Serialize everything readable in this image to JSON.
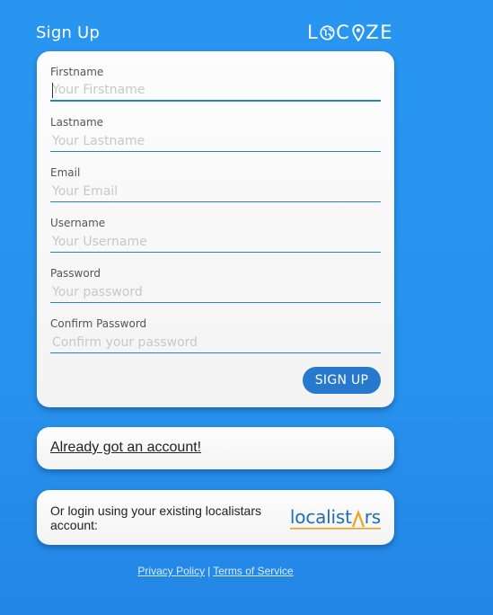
{
  "header": {
    "title": "Sign Up",
    "logo_letters_before": "L",
    "logo_letters_middle": "C",
    "logo_letters_after": "ZE",
    "logo_icons": [
      "globe-icon",
      "map-pin-icon"
    ]
  },
  "form": {
    "fields": [
      {
        "label": "Firstname",
        "placeholder": "Your Firstname",
        "value": ""
      },
      {
        "label": "Lastname",
        "placeholder": "Your Lastname",
        "value": ""
      },
      {
        "label": "Email",
        "placeholder": "Your Email",
        "value": ""
      },
      {
        "label": "Username",
        "placeholder": "Your Username",
        "value": ""
      },
      {
        "label": "Password",
        "placeholder": "Your password",
        "value": ""
      },
      {
        "label": "Confirm Password",
        "placeholder": "Confirm your password",
        "value": ""
      }
    ],
    "submit_label": "SIGN UP"
  },
  "account": {
    "link_text": "Already got an account!"
  },
  "login": {
    "text": "Or login using your existing localistars account:",
    "logo_left": "localist",
    "logo_right": "rs"
  },
  "footer": {
    "privacy": "Privacy Policy",
    "separator": "|",
    "terms": "Terms of Service"
  },
  "colors": {
    "background": "#2792ee",
    "accent": "#2679cc",
    "logo_orange": "#f0a21c"
  }
}
